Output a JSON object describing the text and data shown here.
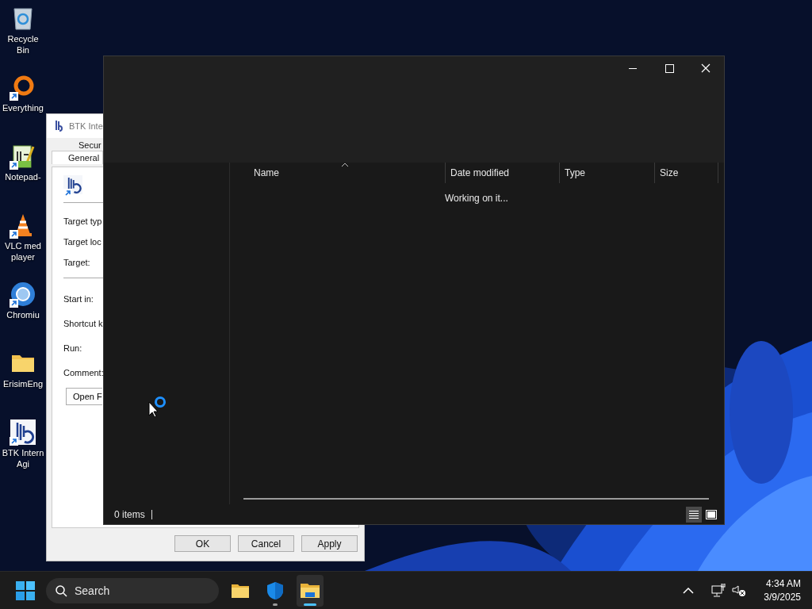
{
  "desktop_icons": [
    {
      "label": "Recycle Bin",
      "kind": "recycle-bin",
      "shortcut": false
    },
    {
      "label": "Everything",
      "kind": "ring",
      "shortcut": true
    },
    {
      "label": "Notepad-",
      "kind": "notepad",
      "shortcut": true
    },
    {
      "label": "VLC med player",
      "kind": "cone",
      "shortcut": true
    },
    {
      "label": "Chromiu",
      "kind": "globe",
      "shortcut": true
    },
    {
      "label": "ErisimEng",
      "kind": "folder",
      "shortcut": false
    },
    {
      "label": "BTK Intern Agi",
      "kind": "app",
      "shortcut": true
    }
  ],
  "properties_dialog": {
    "title": "BTK Inte",
    "tabs": [
      {
        "label": "Secur",
        "selected": false
      },
      {
        "label": "General",
        "selected": true
      }
    ],
    "target_fields": [
      "Target typ",
      "Target loc",
      "Target:"
    ],
    "start_fields": [
      "Start in:",
      "Shortcut k",
      "Run:",
      "Comment:"
    ],
    "open_button": "Open F",
    "buttons": [
      {
        "label": "OK",
        "disabled": false
      },
      {
        "label": "Cancel",
        "disabled": false
      },
      {
        "label": "Apply",
        "disabled": false
      }
    ]
  },
  "explorer": {
    "columns": [
      {
        "label": "Name",
        "sorted": true
      },
      {
        "label": "Date modified",
        "sorted": false
      },
      {
        "label": "Type",
        "sorted": false
      },
      {
        "label": "Size",
        "sorted": false
      }
    ],
    "message": "Working on it...",
    "status": "0 items",
    "views": [
      {
        "kind": "details",
        "selected": true
      },
      {
        "kind": "tiles",
        "selected": false
      }
    ]
  },
  "taskbar": {
    "search_placeholder": "Search",
    "apps": [
      {
        "kind": "folder",
        "running": false,
        "active": false
      },
      {
        "kind": "shield",
        "running": true,
        "active": false
      },
      {
        "kind": "explorer",
        "running": true,
        "active": true
      }
    ],
    "time": "4:34 AM",
    "date": "3/9/2025"
  }
}
